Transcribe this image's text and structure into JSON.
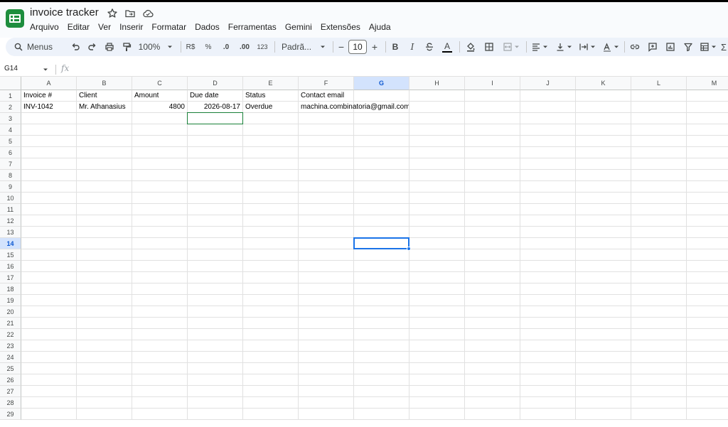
{
  "app": {
    "title": "invoice tracker",
    "icons": [
      "star-icon",
      "move-to-folder-icon",
      "cloud-saved-icon"
    ]
  },
  "menu": [
    "Arquivo",
    "Editar",
    "Ver",
    "Inserir",
    "Formatar",
    "Dados",
    "Ferramentas",
    "Gemini",
    "Extensões",
    "Ajuda"
  ],
  "toolbar": {
    "search_label": "Menus",
    "zoom": "100%",
    "currency_label": "R$",
    "percent_label": "%",
    "decrease_decimal_label": ".0",
    "increase_decimal_label": ".00",
    "more_formats_label": "123",
    "font_label": "Padrã...",
    "minus_label": "−",
    "font_size": "10",
    "plus_label": "+",
    "bold_label": "B",
    "italic_label": "I",
    "text_color_label": "A",
    "sigma_label": "Σ"
  },
  "formula_bar": {
    "name_box": "G14",
    "fx_label": "fx",
    "formula": ""
  },
  "grid": {
    "columns": [
      "A",
      "B",
      "C",
      "D",
      "E",
      "F",
      "G",
      "H",
      "I",
      "J",
      "K",
      "L",
      "M"
    ],
    "row_count": 29,
    "selected_column": "G",
    "selected_row": 14,
    "cells": [
      [
        "Invoice #",
        "Client",
        "Amount",
        "Due date",
        "Status",
        "Contact email"
      ],
      [
        "INV-1042",
        "Mr. Athanasius",
        "4800",
        "2026-08-17",
        "Overdue",
        "machina.combinatoria@gmail.com"
      ]
    ],
    "numeric_columns": [
      2,
      3
    ],
    "highlight_cell": "D3",
    "active_cell": "G14"
  },
  "colors": {
    "accent": "#1a73e8",
    "header_selected": "#d3e3fd",
    "highlight_border": "#188038",
    "app_logo": "#1e8e3e"
  }
}
